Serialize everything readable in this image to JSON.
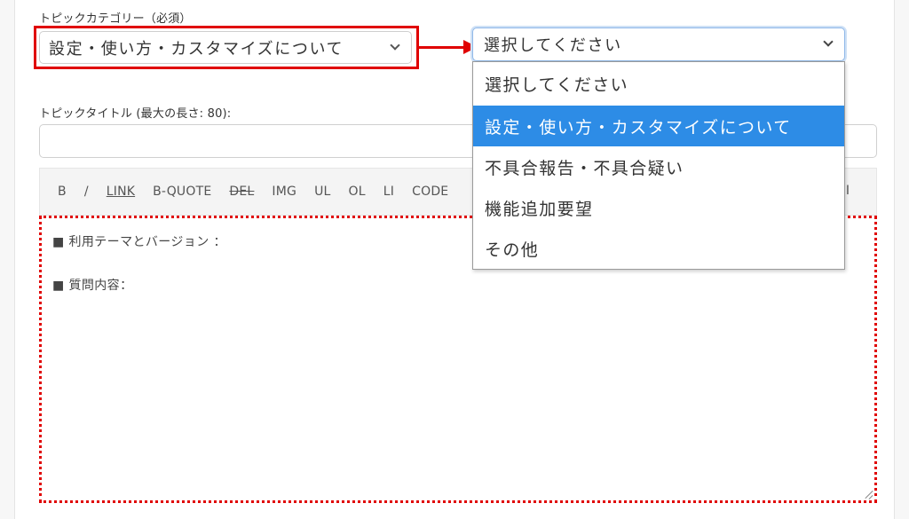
{
  "form": {
    "category_label": "トピックカテゴリー（必須）",
    "category_selected": "設定・使い方・カスタマイズについて",
    "title_label": "トピックタイトル (最大の長さ: 80):",
    "title_value": ""
  },
  "dropdown": {
    "current_value": "選択してください",
    "options": [
      "選択してください",
      "設定・使い方・カスタマイズについて",
      "不具合報告・不具合疑い",
      "機能追加要望",
      "その他"
    ],
    "highlighted_index": 1
  },
  "toolbar": {
    "buttons": [
      "B",
      "/",
      "LINK",
      "B-QUOTE",
      "DEL",
      "IMG",
      "UL",
      "OL",
      "LI",
      "CODE"
    ],
    "right_fragment": "I"
  },
  "editor": {
    "lines": [
      "■ 利用テーマとバージョン ：",
      "■ 質問内容："
    ]
  },
  "colors": {
    "annotation": "#e00000",
    "option_highlight": "#2d8ce6"
  }
}
